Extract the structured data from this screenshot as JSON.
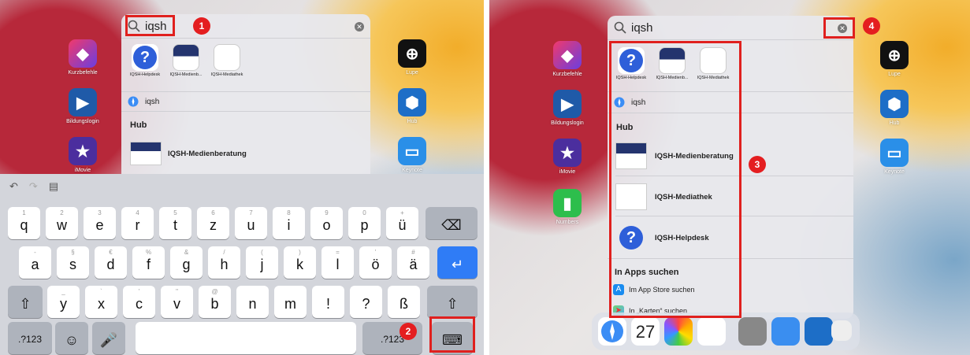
{
  "left": {
    "search_text": "iqsh",
    "home_apps_left": [
      {
        "label": "Kurzbefehle"
      },
      {
        "label": "Bildungslogin"
      },
      {
        "label": "iMovie"
      }
    ],
    "home_apps_right": [
      {
        "label": "Lupe"
      },
      {
        "label": "Hub"
      },
      {
        "label": "Keynote"
      }
    ],
    "tiles": [
      {
        "label": "IQSH-Helpdesk"
      },
      {
        "label": "IQSH-Medienb..."
      },
      {
        "label": "IQSH-Mediathek"
      }
    ],
    "safari_row": "iqsh",
    "section": "Hub",
    "result": "IQSH-Medienberatung",
    "badges": [
      "1",
      "2"
    ],
    "keyboard": {
      "row1": [
        {
          "m": "q",
          "s": "1"
        },
        {
          "m": "w",
          "s": "2"
        },
        {
          "m": "e",
          "s": "3"
        },
        {
          "m": "r",
          "s": "4"
        },
        {
          "m": "t",
          "s": "5"
        },
        {
          "m": "z",
          "s": "6"
        },
        {
          "m": "u",
          "s": "7"
        },
        {
          "m": "i",
          "s": "8"
        },
        {
          "m": "o",
          "s": "9"
        },
        {
          "m": "p",
          "s": "0"
        },
        {
          "m": "ü",
          "s": "+"
        }
      ],
      "row2": [
        {
          "m": "a",
          "s": "-"
        },
        {
          "m": "s",
          "s": "§"
        },
        {
          "m": "d",
          "s": "€"
        },
        {
          "m": "f",
          "s": "%"
        },
        {
          "m": "g",
          "s": "&"
        },
        {
          "m": "h",
          "s": "/"
        },
        {
          "m": "j",
          "s": "("
        },
        {
          "m": "k",
          "s": ")"
        },
        {
          "m": "l",
          "s": "="
        },
        {
          "m": "ö",
          "s": "'"
        },
        {
          "m": "ä",
          "s": "#"
        }
      ],
      "row3": [
        {
          "m": "y",
          "s": "_"
        },
        {
          "m": "x",
          "s": "`"
        },
        {
          "m": "c",
          "s": "'"
        },
        {
          "m": "v",
          "s": "\""
        },
        {
          "m": "b",
          "s": "@"
        },
        {
          "m": "n",
          "s": ""
        },
        {
          "m": "m",
          "s": ""
        },
        {
          "m": "!",
          "s": ""
        },
        {
          "m": "?",
          "s": ""
        },
        {
          "m": "ß",
          "s": ""
        }
      ],
      "row3_sub": [
        "",
        "",
        "",
        "",
        "",
        "",
        "",
        ",",
        "."
      ],
      "numbers_left": ".?123",
      "numbers_right": ".?123"
    }
  },
  "right": {
    "search_text": "iqsh",
    "home_apps_left": [
      {
        "label": "Kurzbefehle"
      },
      {
        "label": "Bildungslogin"
      },
      {
        "label": "iMovie"
      },
      {
        "label": "Numbers"
      }
    ],
    "home_apps_right": [
      {
        "label": "Lupe"
      },
      {
        "label": "Hub"
      },
      {
        "label": "Keynote"
      }
    ],
    "tiles": [
      {
        "label": "IQSH-Helpdesk"
      },
      {
        "label": "IQSH-Medienb..."
      },
      {
        "label": "IQSH-Mediathek"
      }
    ],
    "safari_row": "iqsh",
    "section": "Hub",
    "results": [
      "IQSH-Medienberatung",
      "IQSH-Mediathek",
      "IQSH-Helpdesk"
    ],
    "section2": "In Apps suchen",
    "appstore": "Im App Store suchen",
    "maps": "In „Karten“ suchen",
    "badges": [
      "3",
      "4"
    ],
    "dock_calendar": "27"
  },
  "icons": [
    "search-icon",
    "clear-icon",
    "undo-icon",
    "redo-icon",
    "clipboard-icon",
    "backspace-icon",
    "return-icon",
    "shift-icon",
    "emoji-icon",
    "mic-icon",
    "hide-keyboard-icon",
    "safari-icon",
    "appstore-icon",
    "maps-icon"
  ]
}
